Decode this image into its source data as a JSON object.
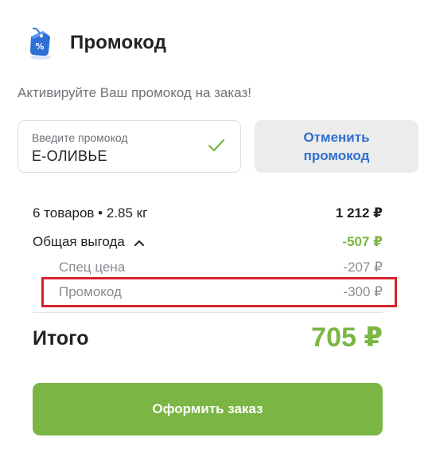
{
  "header": {
    "title": "Промокод",
    "icon": "promo-tag-icon"
  },
  "subtitle": "Активируйте Ваш промокод на заказ!",
  "promo_input": {
    "label": "Введите промокод",
    "value": "Е-ОЛИВЬЕ",
    "status_icon": "check-icon"
  },
  "cancel_button": {
    "label": "Отменить промокод"
  },
  "summary": {
    "items": {
      "label": "6 товаров • 2.85 кг",
      "value": "1 212 ₽"
    },
    "savings": {
      "label": "Общая выгода",
      "value": "-507 ₽",
      "expanded": true
    },
    "special_price": {
      "label": "Спец цена",
      "value": "-207 ₽"
    },
    "promo": {
      "label": "Промокод",
      "value": "-300 ₽"
    }
  },
  "total": {
    "label": "Итого",
    "value": "705 ₽"
  },
  "order_button": {
    "label": "Оформить заказ"
  },
  "colors": {
    "accent_green": "#7bb544",
    "link_blue": "#2f6fd0",
    "highlight_red": "#d8232a"
  }
}
